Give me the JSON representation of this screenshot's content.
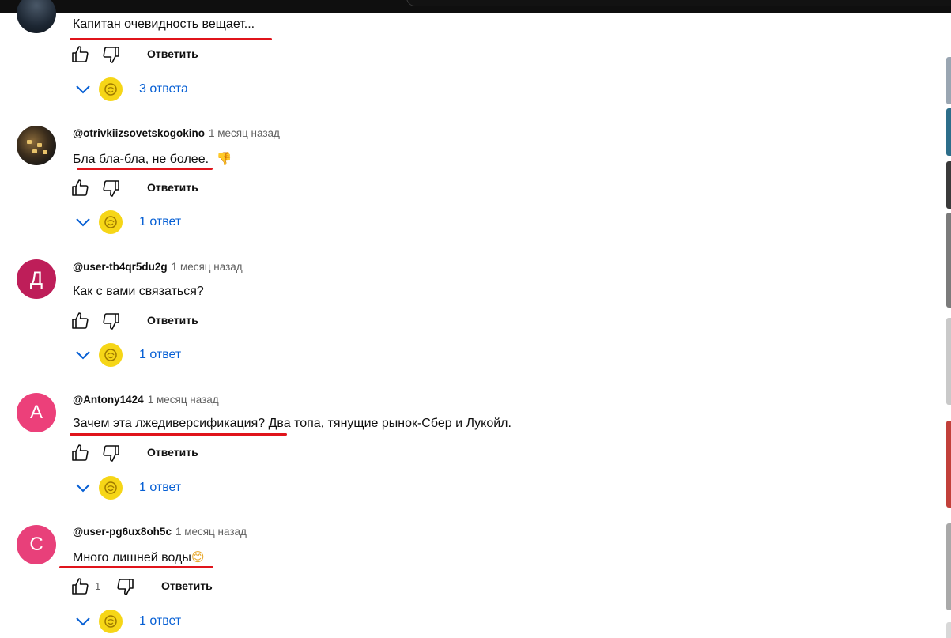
{
  "colors": {
    "underline": "#e0141b",
    "link": "#065fd4",
    "creator_badge": "#f6d617",
    "avatar_d": "#be1e59",
    "avatar_a": "#ec407a",
    "avatar_c": "#e8407a"
  },
  "icons": {
    "like": "thumbs-up-icon",
    "dislike": "thumbs-down-icon",
    "expand": "chevron-down-icon",
    "creator": "creator-avatar-icon"
  },
  "comments": [
    {
      "author": "",
      "time": "",
      "avatar_letter": "",
      "text": "Капитан очевидность вещает...",
      "emoji": "",
      "likes": "",
      "reply_label": "Ответить",
      "replies": "3 ответа"
    },
    {
      "author": "@otrivkiizsovetskogokino",
      "time": "1 месяц назад",
      "avatar_letter": "",
      "text": "Бла бла-бла, не более.",
      "emoji": "👎",
      "likes": "",
      "reply_label": "Ответить",
      "replies": "1 ответ"
    },
    {
      "author": "@user-tb4qr5du2g",
      "time": "1 месяц назад",
      "avatar_letter": "Д",
      "text": "Как с вами связаться?",
      "emoji": "",
      "likes": "",
      "reply_label": "Ответить",
      "replies": "1 ответ"
    },
    {
      "author": "@Antony1424",
      "time": "1 месяц назад",
      "avatar_letter": "A",
      "text": "Зачем эта лжедиверсификация? Два топа, тянущие рынок-Сбер и Лукойл.",
      "emoji": "",
      "likes": "",
      "reply_label": "Ответить",
      "replies": "1 ответ"
    },
    {
      "author": "@user-pg6ux8oh5c",
      "time": "1 месяц назад",
      "avatar_letter": "C",
      "text": "Много лишней воды",
      "emoji": "😊",
      "likes": "1",
      "reply_label": "Ответить",
      "replies": "1 ответ"
    }
  ]
}
